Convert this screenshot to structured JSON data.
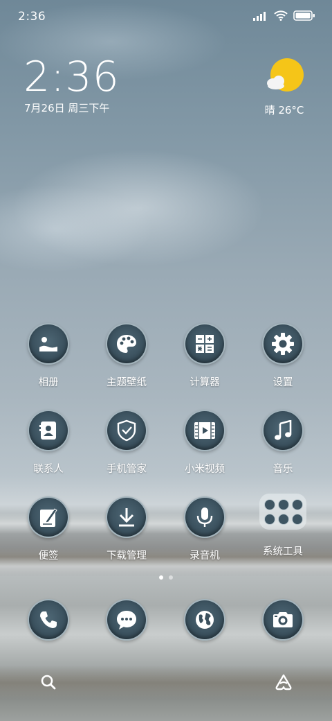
{
  "status_bar": {
    "time": "2:36",
    "icons": [
      "signal-icon",
      "wifi-icon",
      "battery-icon"
    ]
  },
  "lockscreen": {
    "clock": "2:36",
    "date": "7月26日 周三下午"
  },
  "weather": {
    "icon": "partly-sunny-icon",
    "text": "晴 26°C"
  },
  "apps": [
    {
      "label": "相册",
      "icon": "gallery-icon"
    },
    {
      "label": "主题壁纸",
      "icon": "palette-icon"
    },
    {
      "label": "计算器",
      "icon": "calculator-icon"
    },
    {
      "label": "设置",
      "icon": "gear-icon"
    },
    {
      "label": "联系人",
      "icon": "contacts-icon"
    },
    {
      "label": "手机管家",
      "icon": "shield-icon"
    },
    {
      "label": "小米视频",
      "icon": "video-icon"
    },
    {
      "label": "音乐",
      "icon": "music-note-icon"
    },
    {
      "label": "便签",
      "icon": "notes-icon"
    },
    {
      "label": "下载管理",
      "icon": "download-icon"
    },
    {
      "label": "录音机",
      "icon": "microphone-icon"
    },
    {
      "label": "系统工具",
      "icon": "folder-icon"
    }
  ],
  "dock": [
    {
      "icon": "phone-icon"
    },
    {
      "icon": "message-icon"
    },
    {
      "icon": "browser-globe-icon"
    },
    {
      "icon": "camera-icon"
    }
  ],
  "page_indicator": {
    "count": 2,
    "active": 1
  },
  "bottom_bar": {
    "left_icon": "search-icon",
    "right_icon": "assistant-icon"
  },
  "colors": {
    "icon_bg": "#3a505d",
    "weather_sun": "#f5c518"
  }
}
